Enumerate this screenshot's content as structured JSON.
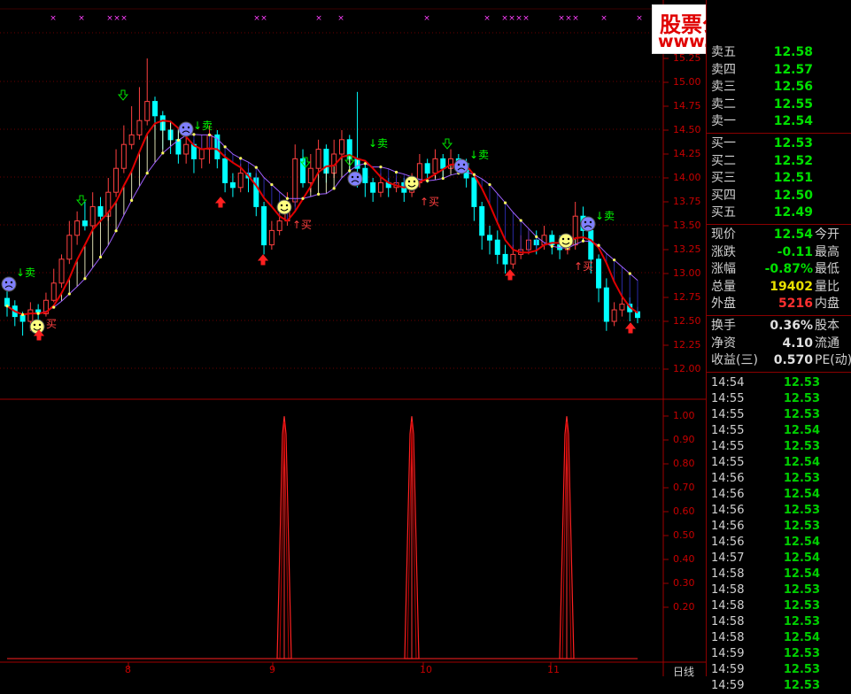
{
  "watermark": {
    "line1": "股票公式指标网",
    "line2": "www.gszb.com"
  },
  "price_axis": [
    "15.25",
    "15.00",
    "14.75",
    "14.50",
    "14.25",
    "14.00",
    "13.75",
    "13.50",
    "13.25",
    "13.00",
    "12.75",
    "12.50",
    "12.25",
    "12.00"
  ],
  "ind_axis": [
    "1.00",
    "0.90",
    "0.80",
    "0.70",
    "0.60",
    "0.50",
    "0.40",
    "0.30",
    "0.20"
  ],
  "dates": [
    "8",
    "9",
    "10",
    "11"
  ],
  "period_label": "日线",
  "signals": {
    "buy": "买",
    "sell": "卖",
    "buy_up": "↑买",
    "sell_down": "↓卖"
  },
  "order_book": [
    {
      "label": "卖五",
      "value": "12.58",
      "color": "#00e000"
    },
    {
      "label": "卖四",
      "value": "12.57",
      "color": "#00e000"
    },
    {
      "label": "卖三",
      "value": "12.56",
      "color": "#00e000"
    },
    {
      "label": "卖二",
      "value": "12.55",
      "color": "#00e000"
    },
    {
      "label": "卖一",
      "value": "12.54",
      "color": "#00e000"
    },
    {
      "label": "买一",
      "value": "12.53",
      "color": "#00e000"
    },
    {
      "label": "买二",
      "value": "12.52",
      "color": "#00e000"
    },
    {
      "label": "买三",
      "value": "12.51",
      "color": "#00e000"
    },
    {
      "label": "买四",
      "value": "12.50",
      "color": "#00e000"
    },
    {
      "label": "买五",
      "value": "12.49",
      "color": "#00e000"
    }
  ],
  "quote": [
    {
      "label": "现价",
      "value": "12.54",
      "color": "#00e000",
      "label2": "今开"
    },
    {
      "label": "涨跌",
      "value": "-0.11",
      "color": "#00e000",
      "label2": "最高"
    },
    {
      "label": "涨幅",
      "value": "-0.87%",
      "color": "#00e000",
      "label2": "最低"
    },
    {
      "label": "总量",
      "value": "19402",
      "color": "#e8e000",
      "label2": "量比"
    },
    {
      "label": "外盘",
      "value": "5216",
      "color": "#ff3030",
      "label2": "内盘"
    }
  ],
  "fund": [
    {
      "label": "换手",
      "value": "0.36%",
      "color": "#e0e0e0",
      "label2": "股本"
    },
    {
      "label": "净资",
      "value": "4.10",
      "color": "#e0e0e0",
      "label2": "流通"
    },
    {
      "label": "收益(三)",
      "value": "0.570",
      "color": "#e0e0e0",
      "label2": "PE(动)"
    }
  ],
  "ticks": [
    {
      "t": "14:54",
      "p": "12.53"
    },
    {
      "t": "14:55",
      "p": "12.53"
    },
    {
      "t": "14:55",
      "p": "12.53"
    },
    {
      "t": "14:55",
      "p": "12.54"
    },
    {
      "t": "14:55",
      "p": "12.53"
    },
    {
      "t": "14:55",
      "p": "12.54"
    },
    {
      "t": "14:56",
      "p": "12.53"
    },
    {
      "t": "14:56",
      "p": "12.54"
    },
    {
      "t": "14:56",
      "p": "12.53"
    },
    {
      "t": "14:56",
      "p": "12.53"
    },
    {
      "t": "14:56",
      "p": "12.54"
    },
    {
      "t": "14:57",
      "p": "12.54"
    },
    {
      "t": "14:58",
      "p": "12.54"
    },
    {
      "t": "14:58",
      "p": "12.53"
    },
    {
      "t": "14:58",
      "p": "12.53"
    },
    {
      "t": "14:58",
      "p": "12.53"
    },
    {
      "t": "14:58",
      "p": "12.54"
    },
    {
      "t": "14:59",
      "p": "12.53"
    },
    {
      "t": "14:59",
      "p": "12.53"
    },
    {
      "t": "14:59",
      "p": "12.53"
    }
  ],
  "chart_data": {
    "type": "candlestick",
    "y_range": [
      12.0,
      15.3
    ],
    "candles": [
      [
        12.74,
        12.66,
        12.85,
        12.55
      ],
      [
        12.66,
        12.55,
        12.72,
        12.45
      ],
      [
        12.56,
        12.5,
        12.6,
        12.35
      ],
      [
        12.5,
        12.62,
        12.7,
        12.4
      ],
      [
        12.62,
        12.58,
        12.68,
        12.5
      ],
      [
        12.58,
        12.72,
        12.8,
        12.55
      ],
      [
        12.72,
        12.9,
        13.05,
        12.7
      ],
      [
        12.9,
        13.15,
        13.2,
        12.85
      ],
      [
        13.15,
        13.4,
        13.55,
        13.1
      ],
      [
        13.4,
        13.55,
        13.65,
        13.3
      ],
      [
        13.55,
        13.5,
        13.75,
        13.45
      ],
      [
        13.5,
        13.7,
        13.85,
        13.45
      ],
      [
        13.7,
        13.6,
        13.8,
        13.55
      ],
      [
        13.6,
        13.85,
        14.0,
        13.55
      ],
      [
        13.85,
        14.1,
        14.3,
        13.8
      ],
      [
        14.1,
        14.35,
        14.55,
        14.05
      ],
      [
        14.35,
        14.45,
        14.75,
        14.3
      ],
      [
        14.45,
        14.6,
        14.95,
        14.4
      ],
      [
        14.6,
        14.8,
        15.25,
        14.55
      ],
      [
        14.8,
        14.65,
        14.85,
        14.4
      ],
      [
        14.65,
        14.5,
        14.7,
        14.3
      ],
      [
        14.5,
        14.4,
        14.6,
        14.25
      ],
      [
        14.4,
        14.25,
        14.5,
        14.15
      ],
      [
        14.25,
        14.35,
        14.45,
        14.15
      ],
      [
        14.35,
        14.2,
        14.4,
        14.05
      ],
      [
        14.2,
        14.3,
        14.45,
        14.1
      ],
      [
        14.3,
        14.45,
        14.55,
        14.15
      ],
      [
        14.45,
        14.2,
        14.5,
        14.1
      ],
      [
        14.2,
        13.95,
        14.25,
        13.85
      ],
      [
        13.95,
        13.9,
        14.05,
        13.8
      ],
      [
        13.9,
        14.05,
        14.15,
        13.85
      ],
      [
        14.05,
        14.0,
        14.1,
        13.85
      ],
      [
        14.0,
        13.7,
        14.05,
        13.6
      ],
      [
        13.7,
        13.3,
        13.75,
        13.2
      ],
      [
        13.3,
        13.45,
        13.55,
        13.25
      ],
      [
        13.45,
        13.55,
        13.7,
        13.4
      ],
      [
        13.55,
        13.75,
        13.85,
        13.5
      ],
      [
        13.75,
        14.2,
        14.35,
        13.7
      ],
      [
        14.2,
        13.95,
        14.3,
        13.9
      ],
      [
        13.95,
        14.1,
        14.25,
        13.85
      ],
      [
        14.1,
        14.3,
        14.4,
        14.05
      ],
      [
        14.3,
        14.05,
        14.35,
        13.95
      ],
      [
        14.05,
        14.25,
        14.4,
        14.0
      ],
      [
        14.25,
        14.4,
        14.5,
        14.2
      ],
      [
        14.4,
        14.2,
        14.45,
        14.05
      ],
      [
        14.2,
        14.1,
        14.9,
        13.9
      ],
      [
        14.1,
        13.95,
        14.15,
        13.8
      ],
      [
        13.95,
        13.85,
        14.0,
        13.75
      ],
      [
        13.85,
        13.95,
        14.05,
        13.8
      ],
      [
        13.95,
        13.9,
        14.0,
        13.8
      ],
      [
        13.9,
        13.95,
        14.0,
        13.85
      ],
      [
        13.95,
        13.85,
        14.0,
        13.75
      ],
      [
        13.85,
        13.95,
        14.05,
        13.8
      ],
      [
        13.95,
        14.15,
        14.25,
        13.9
      ],
      [
        14.15,
        14.05,
        14.2,
        13.95
      ],
      [
        14.05,
        14.2,
        14.3,
        14.0
      ],
      [
        14.2,
        14.1,
        14.25,
        14.0
      ],
      [
        14.1,
        14.2,
        14.3,
        14.05
      ],
      [
        14.2,
        14.15,
        14.25,
        14.05
      ],
      [
        14.15,
        14.0,
        14.2,
        13.9
      ],
      [
        14.0,
        13.7,
        14.05,
        13.55
      ],
      [
        13.7,
        13.4,
        13.75,
        13.25
      ],
      [
        13.4,
        13.35,
        13.5,
        13.2
      ],
      [
        13.35,
        13.2,
        13.45,
        13.1
      ],
      [
        13.2,
        13.1,
        13.3,
        13.0
      ],
      [
        13.1,
        13.2,
        13.3,
        13.05
      ],
      [
        13.2,
        13.25,
        13.4,
        13.15
      ],
      [
        13.25,
        13.35,
        13.45,
        13.2
      ],
      [
        13.35,
        13.3,
        13.45,
        13.2
      ],
      [
        13.3,
        13.4,
        13.5,
        13.25
      ],
      [
        13.4,
        13.3,
        13.45,
        13.2
      ],
      [
        13.3,
        13.25,
        13.4,
        13.15
      ],
      [
        13.25,
        13.3,
        13.4,
        13.2
      ],
      [
        13.3,
        13.6,
        13.75,
        13.25
      ],
      [
        13.6,
        13.45,
        13.7,
        13.35
      ],
      [
        13.45,
        13.15,
        13.5,
        13.0
      ],
      [
        13.15,
        12.85,
        13.2,
        12.7
      ],
      [
        12.85,
        12.5,
        12.95,
        12.4
      ],
      [
        12.5,
        12.62,
        12.7,
        12.45
      ],
      [
        12.62,
        12.68,
        12.75,
        12.55
      ],
      [
        12.68,
        12.6,
        12.75,
        12.5
      ],
      [
        12.6,
        12.54,
        12.65,
        12.48
      ]
    ],
    "spikes": [
      0.999,
      0.999,
      0.999
    ]
  }
}
